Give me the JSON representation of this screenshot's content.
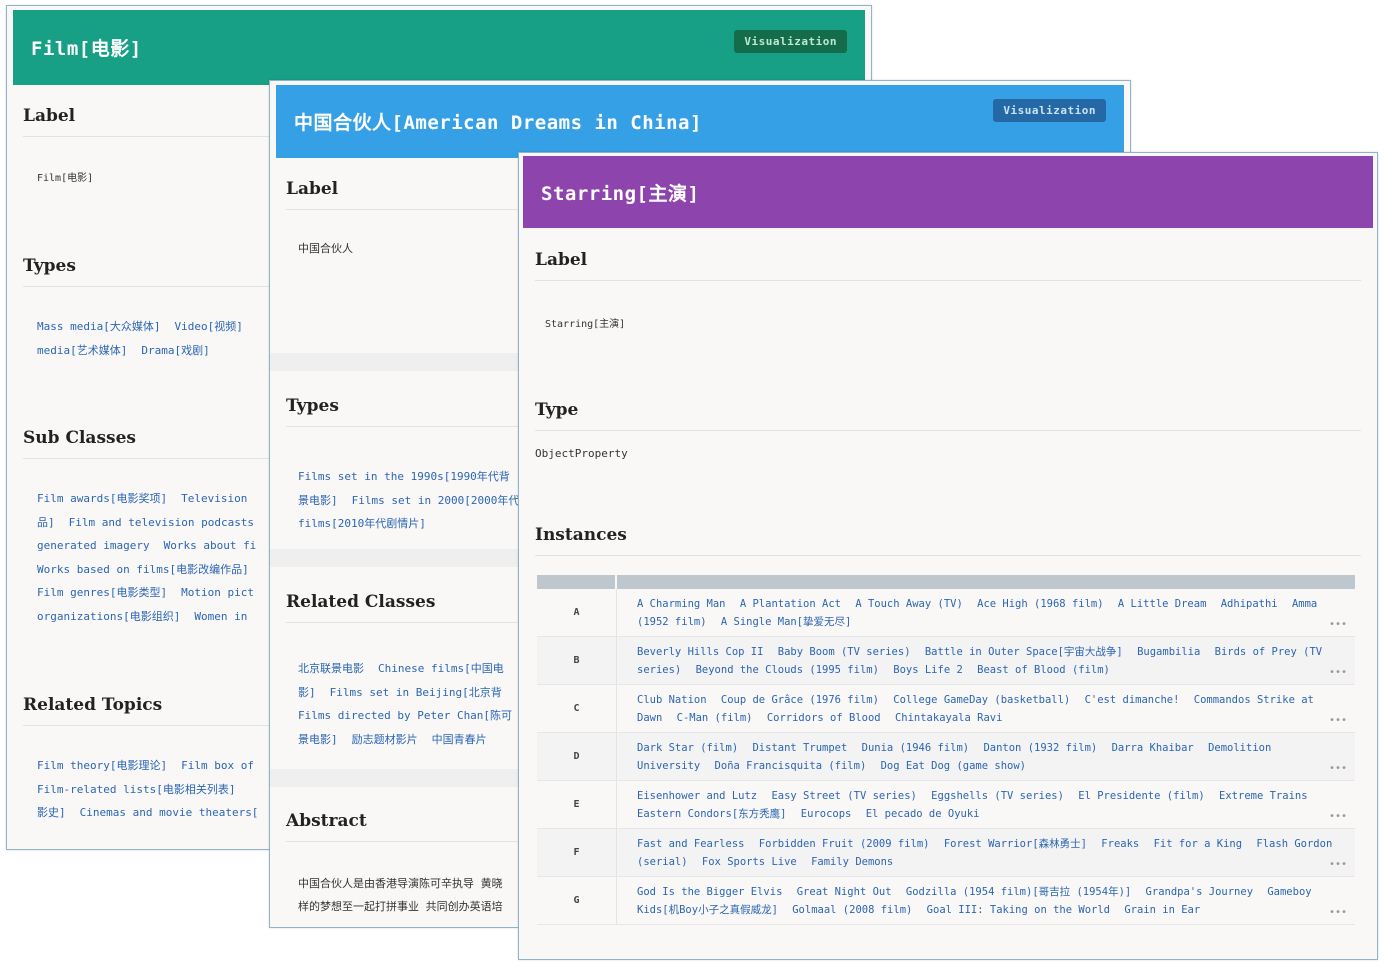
{
  "card1": {
    "title": "Film[电影]",
    "viz_label": "Visualization",
    "label_heading": "Label",
    "label_value": "Film[电影]",
    "types_heading": "Types",
    "types": [
      "Mass media[大众媒体]",
      "Video[视频]",
      "media[艺术媒体]",
      "Drama[戏剧]"
    ],
    "subclasses_heading": "Sub Classes",
    "subclasses": [
      "Film awards[电影奖项]",
      "Television",
      "品]",
      "Film and television podcasts",
      "generated imagery",
      "Works about fi",
      "Works based on films[电影改编作品]",
      "Film genres[电影类型]",
      "Motion pict",
      "organizations[电影组织]",
      "Women in"
    ],
    "related_topics_heading": "Related Topics",
    "related_topics": [
      "Film theory[电影理论]",
      "Film box of",
      "Film-related lists[电影相关列表]",
      "影史]",
      "Cinemas and movie theaters["
    ]
  },
  "card2": {
    "title": "中国合伙人[American Dreams in China]",
    "viz_label": "Visualization",
    "label_heading": "Label",
    "label_value": "中国合伙人",
    "types_heading": "Types",
    "types": [
      "Films set in the 1990s[1990年代背",
      "景电影]",
      "Films set in 2000[2000年代",
      "films[2010年代剧情片]"
    ],
    "related_classes_heading": "Related Classes",
    "related_classes": [
      "北京联景电影",
      "Chinese films[中国电",
      "影]",
      "Films set in Beijing[北京背",
      "Films directed by Peter Chan[陈可",
      "景电影]",
      "励志题材影片",
      "中国青春片"
    ],
    "abstract_heading": "Abstract",
    "abstract_lines": [
      "中国合伙人是由香港导演陈可辛执导 黄晓",
      "样的梦想至一起打拼事业 共同创办英语培"
    ]
  },
  "card3": {
    "title": "Starring[主演]",
    "label_heading": "Label",
    "label_value": "Starring[主演]",
    "type_heading": "Type",
    "type_value": "ObjectProperty",
    "instances_heading": "Instances",
    "more_glyph": "•••",
    "rows": [
      {
        "letter": "A",
        "items": [
          "A Charming Man",
          "A Plantation Act",
          "A Touch Away (TV)",
          "Ace High (1968 film)",
          "A Little Dream",
          "Adhipathi",
          "Amma (1952 film)",
          "A Single Man[挚爱无尽]"
        ]
      },
      {
        "letter": "B",
        "items": [
          "Beverly Hills Cop II",
          "Baby Boom (TV series)",
          "Battle in Outer Space[宇宙大战争]",
          "Bugambilia",
          "Birds of Prey (TV series)",
          "Beyond the Clouds (1995 film)",
          "Boys Life 2",
          "Beast of Blood (film)"
        ]
      },
      {
        "letter": "C",
        "items": [
          "Club Nation",
          "Coup de Grâce (1976 film)",
          "College GameDay (basketball)",
          "C'est dimanche!",
          "Commandos Strike at Dawn",
          "C-Man (film)",
          "Corridors of Blood",
          "Chintakayala Ravi"
        ]
      },
      {
        "letter": "D",
        "items": [
          "Dark Star (film)",
          "Distant Trumpet",
          "Dunia (1946 film)",
          "Danton (1932 film)",
          "Darra Khaibar",
          "Demolition University",
          "Doña Francisquita (film)",
          "Dog Eat Dog (game show)"
        ]
      },
      {
        "letter": "E",
        "items": [
          "Eisenhower and Lutz",
          "Easy Street (TV series)",
          "Eggshells (TV series)",
          "El Presidente (film)",
          "Extreme Trains",
          "Eastern Condors[东方秃鹰]",
          "Eurocops",
          "El pecado de Oyuki"
        ]
      },
      {
        "letter": "F",
        "items": [
          "Fast and Fearless",
          "Forbidden Fruit (2009 film)",
          "Forest Warrior[森林勇士]",
          "Freaks",
          "Fit for a King",
          "Flash Gordon (serial)",
          "Fox Sports Live",
          "Family Demons"
        ]
      },
      {
        "letter": "G",
        "items": [
          "God Is the Bigger Elvis",
          "Great Night Out",
          "Godzilla (1954 film)[哥吉拉 (1954年)]",
          "Grandpa's Journey",
          "Gameboy Kids[机Boy小子之真假威龙]",
          "Golmaal (2008 film)",
          "Goal III: Taking on the World",
          "Grain in Ear"
        ]
      }
    ]
  },
  "colors": {
    "film_header": "#17a085",
    "movie_header": "#36a0e6",
    "starring_header": "#8e44ad",
    "link": "#2b65b3"
  }
}
